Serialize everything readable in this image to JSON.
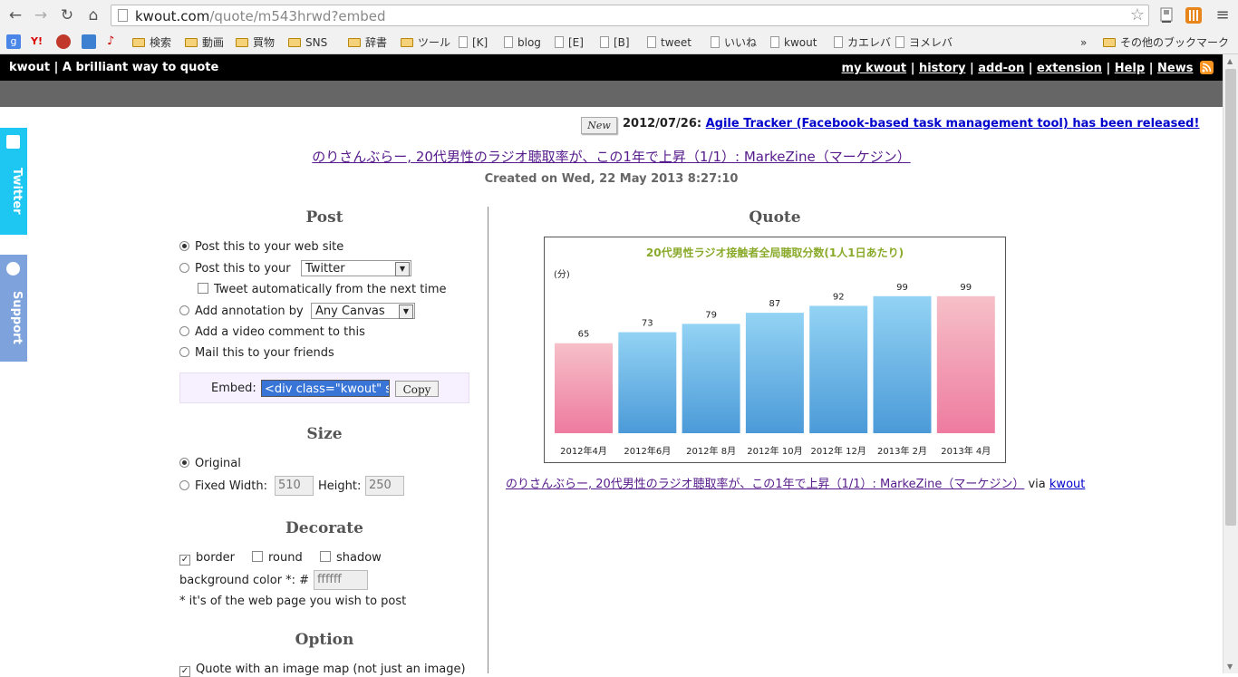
{
  "browser": {
    "url_host": "kwout.com",
    "url_path": "/quote/m543hrwd?embed",
    "bookmarks": [
      {
        "label": "検索",
        "type": "folder"
      },
      {
        "label": "動画",
        "type": "folder"
      },
      {
        "label": "買物",
        "type": "folder"
      },
      {
        "label": "SNS",
        "type": "folder"
      },
      {
        "label": "辞書",
        "type": "folder"
      },
      {
        "label": "ツール",
        "type": "folder"
      },
      {
        "label": "[K]",
        "type": "page"
      },
      {
        "label": "blog",
        "type": "page"
      },
      {
        "label": "[E]",
        "type": "page"
      },
      {
        "label": "[B]",
        "type": "page"
      },
      {
        "label": "tweet",
        "type": "page"
      },
      {
        "label": "いいね",
        "type": "page"
      },
      {
        "label": "kwout",
        "type": "page"
      },
      {
        "label": "カエレバ",
        "type": "page"
      },
      {
        "label": "ヨメレバ",
        "type": "page"
      }
    ],
    "bookmarks_overflow": "»",
    "other_bookmarks": "その他のブックマーク"
  },
  "site": {
    "brand": "kwout | A brilliant way to quote",
    "nav": [
      "my kwout",
      "history",
      "add-on",
      "extension",
      "Help",
      "News"
    ],
    "separator": "|",
    "side_tabs": {
      "twitter": "Twitter",
      "support": "Support"
    }
  },
  "news": {
    "badge": "New",
    "date": "2012/07/26:",
    "link": "Agile Tracker (Facebook-based task management tool) has been released!"
  },
  "page": {
    "title": "のりさんぶらー, 20代男性のラジオ聴取率が、この1年で上昇（1/1）: MarkeZine（マーケジン）",
    "created": "Created on Wed, 22 May 2013 8:27:10"
  },
  "post": {
    "title": "Post",
    "options": {
      "web": "Post this to your web site",
      "service": "Post this to your",
      "service_selected": "Twitter",
      "tweet_auto": "Tweet automatically from the next time",
      "annotation": "Add annotation by",
      "annotation_selected": "Any Canvas",
      "video": "Add a video comment to this",
      "mail": "Mail this to your friends"
    },
    "embed_label": "Embed:",
    "embed_value": "<div class=\"kwout\" st",
    "copy_label": "Copy"
  },
  "size": {
    "title": "Size",
    "original": "Original",
    "fixed_width": "Fixed Width:",
    "width_value": "510",
    "height_label": "Height:",
    "height_value": "250"
  },
  "decorate": {
    "title": "Decorate",
    "border": "border",
    "round": "round",
    "shadow": "shadow",
    "bg_label": "background color *: #",
    "bg_value": "ffffff",
    "note": "* it's of the web page you wish to post"
  },
  "option": {
    "title": "Option",
    "imagemap": "Quote with an image map (not just an image)"
  },
  "quote": {
    "title": "Quote",
    "caption_link": "のりさんぶらー, 20代男性のラジオ聴取率が、この1年で上昇（1/1）: MarkeZine（マーケジン）",
    "via": "via",
    "via_link": "kwout"
  },
  "colors": {
    "chart_title": "#8aaa2b",
    "bar_blue_top": "#93d3f4",
    "bar_blue_bottom": "#4b9ad8",
    "bar_pink_top": "#f6c0c8",
    "bar_pink_bottom": "#ee7ba0"
  },
  "chart_data": {
    "type": "bar",
    "title": "20代男性ラジオ接触者全局聴取分数(1人1日あたり)",
    "unit_label": "(分)",
    "categories": [
      "2012年4月",
      "2012年6月",
      "2012年 8月",
      "2012年 10月",
      "2012年 12月",
      "2013年 2月",
      "2013年 4月"
    ],
    "values": [
      65,
      73,
      79,
      87,
      92,
      99,
      99
    ],
    "highlight": [
      true,
      false,
      false,
      false,
      false,
      false,
      true
    ],
    "ylim": [
      0,
      110
    ],
    "grid": false
  }
}
